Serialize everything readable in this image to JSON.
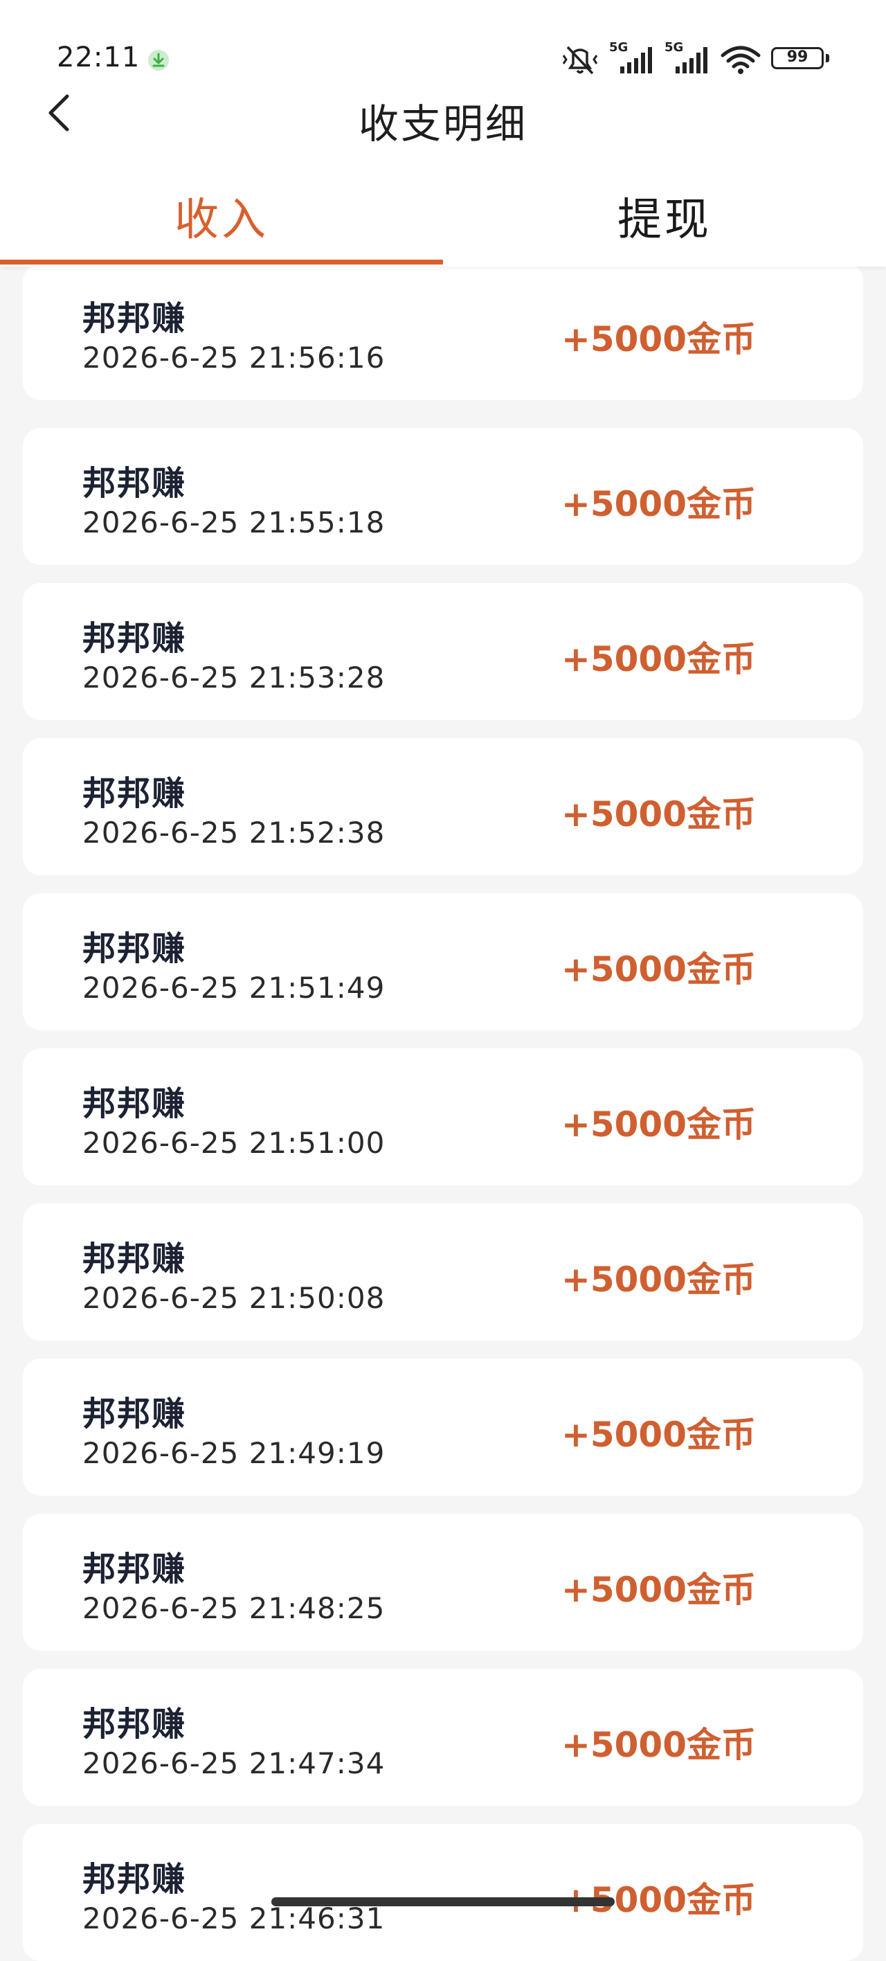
{
  "status_bar": {
    "time": "22:11",
    "battery": "99",
    "network_1": "5G",
    "network_2": "5G"
  },
  "nav": {
    "title": "收支明细"
  },
  "tabs": [
    {
      "label": "收入",
      "active": true
    },
    {
      "label": "提现",
      "active": false
    }
  ],
  "accent_color": "#d95f2c",
  "records": [
    {
      "name": "邦邦赚",
      "time": "2026-6-25 21:56:16",
      "amount": "+5000金币"
    },
    {
      "name": "邦邦赚",
      "time": "2026-6-25 21:55:18",
      "amount": "+5000金币"
    },
    {
      "name": "邦邦赚",
      "time": "2026-6-25 21:53:28",
      "amount": "+5000金币"
    },
    {
      "name": "邦邦赚",
      "time": "2026-6-25 21:52:38",
      "amount": "+5000金币"
    },
    {
      "name": "邦邦赚",
      "time": "2026-6-25 21:51:49",
      "amount": "+5000金币"
    },
    {
      "name": "邦邦赚",
      "time": "2026-6-25 21:51:00",
      "amount": "+5000金币"
    },
    {
      "name": "邦邦赚",
      "time": "2026-6-25 21:50:08",
      "amount": "+5000金币"
    },
    {
      "name": "邦邦赚",
      "time": "2026-6-25 21:49:19",
      "amount": "+5000金币"
    },
    {
      "name": "邦邦赚",
      "time": "2026-6-25 21:48:25",
      "amount": "+5000金币"
    },
    {
      "name": "邦邦赚",
      "time": "2026-6-25 21:47:34",
      "amount": "+5000金币"
    },
    {
      "name": "邦邦赚",
      "time": "2026-6-25 21:46:31",
      "amount": "+5000金币"
    }
  ]
}
